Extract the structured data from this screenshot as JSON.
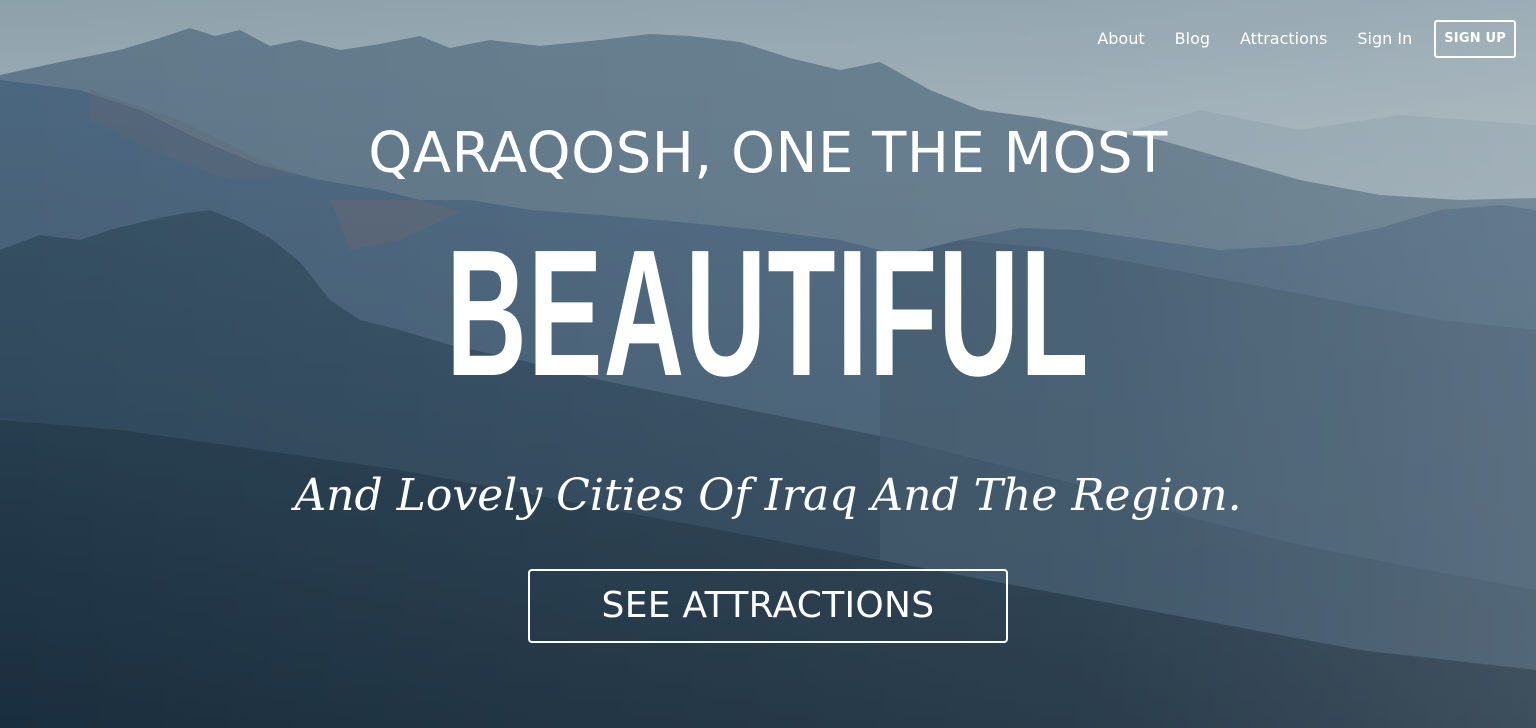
{
  "nav": {
    "items": [
      {
        "label": "About"
      },
      {
        "label": "Blog"
      },
      {
        "label": "Attractions"
      },
      {
        "label": "Sign In"
      }
    ],
    "signup_label": "SIGN UP"
  },
  "hero": {
    "headline_top": "QARAQOSH, ONE THE MOST",
    "headline_main": "BEAUTIFUL",
    "subheadline": "And Lovely Cities Of Iraq And The Region.",
    "cta_label": "SEE ATTRACTIONS",
    "background": "misty-mountain-range-photo"
  },
  "colors": {
    "sky": "#c9d6db",
    "far_mountains": "#7e97a6",
    "mid_mountains": "#4f6b80",
    "near_mountains": "#2d4659",
    "foreground": "#1c3142",
    "text": "#ffffff"
  }
}
